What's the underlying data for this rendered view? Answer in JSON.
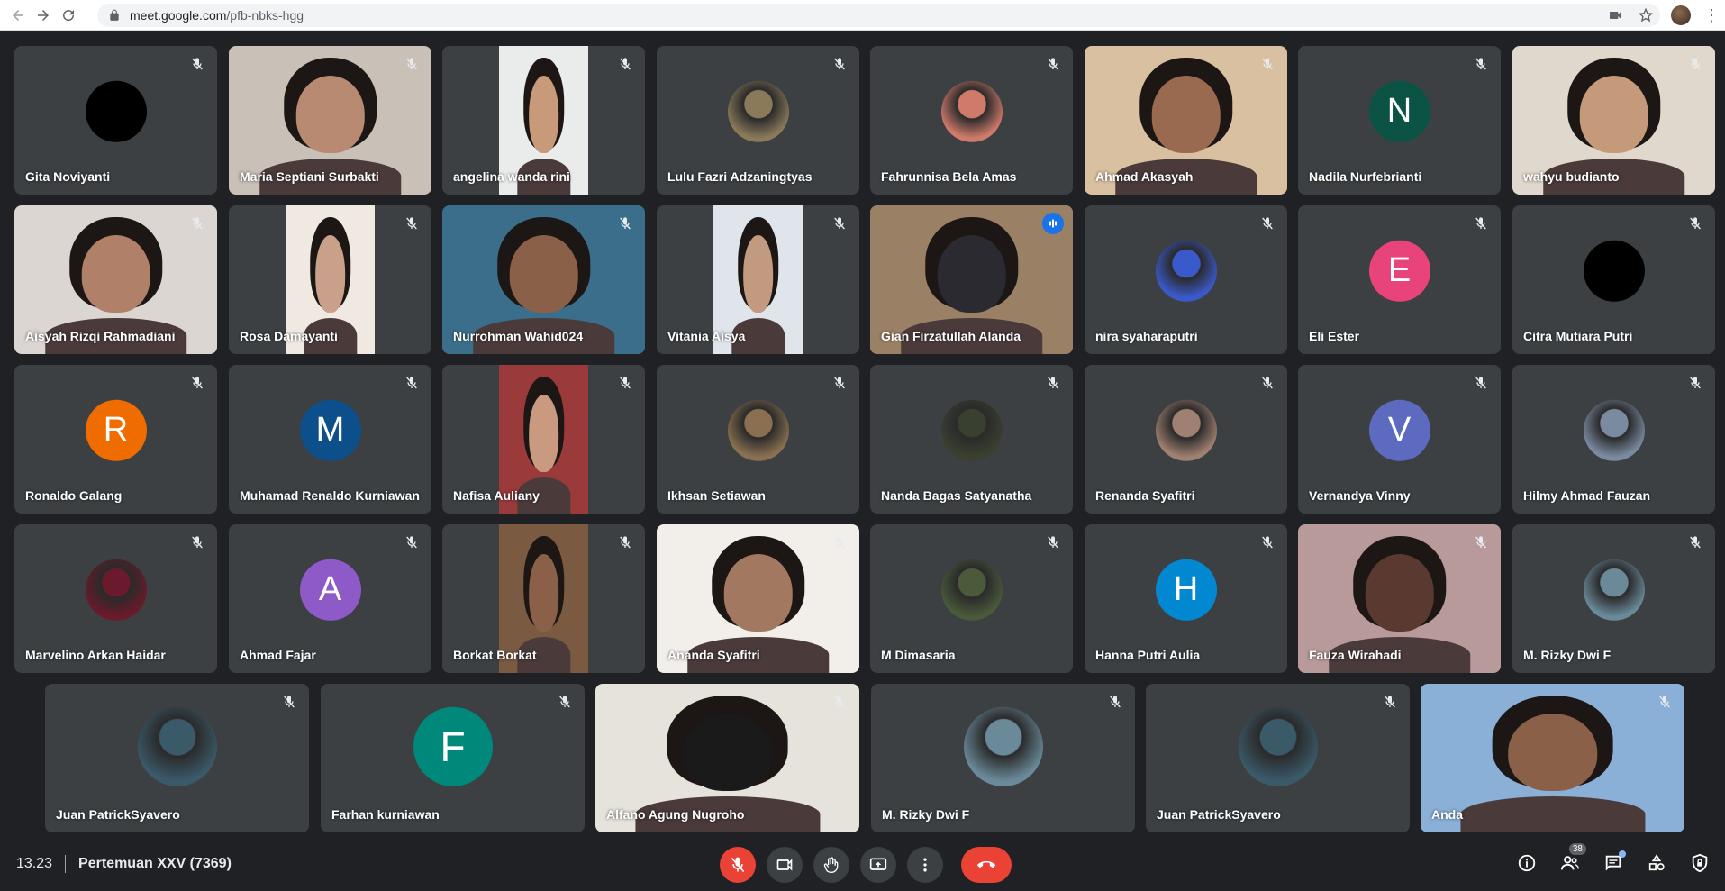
{
  "browser": {
    "url_host": "meet.google.com",
    "url_path": "/pfb-nbks-hgg"
  },
  "colors": {
    "tile_bg": "#3c4043",
    "page_bg": "#202124",
    "accent": "#8ab4f8",
    "danger": "#ea4335"
  },
  "participants": [
    {
      "name": "Gita Noviyanti",
      "kind": "avatar",
      "initial": "",
      "color": "#000000"
    },
    {
      "name": "Maria Septiani Surbakti",
      "kind": "video",
      "tone": "#b98a72",
      "bg": "#c9c0b8"
    },
    {
      "name": "angelina wanda rini",
      "kind": "video-inset",
      "tone": "#c99a7a",
      "bg": "#e9ecea"
    },
    {
      "name": "Lulu Fazri Adzaningtyas",
      "kind": "photo",
      "tone": "#8a7a5a"
    },
    {
      "name": "Fahrunnisa Bela Amas",
      "kind": "photo",
      "tone": "#d07a6a"
    },
    {
      "name": "Ahmad Akasyah",
      "kind": "video",
      "tone": "#9a6a50",
      "bg": "#d8c0a0"
    },
    {
      "name": "Nadila Nurfebrianti",
      "kind": "avatar",
      "initial": "N",
      "color": "#0b5345"
    },
    {
      "name": "wahyu budianto",
      "kind": "video",
      "tone": "#c49a7a",
      "bg": "#e0d8cc"
    },
    {
      "name": "Aisyah Rizqi Rahmadiani",
      "kind": "video",
      "tone": "#b08068",
      "bg": "#dcd6d2"
    },
    {
      "name": "Rosa Damayanti",
      "kind": "video-inset",
      "tone": "#c9a08a",
      "bg": "#efe9e2"
    },
    {
      "name": "Nurrohman Wahid024",
      "kind": "video",
      "tone": "#8a6048",
      "bg": "#3a6e8a"
    },
    {
      "name": "Vitania Aisya",
      "kind": "video-inset",
      "tone": "#c29a80",
      "bg": "#dfe5ea"
    },
    {
      "name": "Gian Firzatullah Alanda",
      "kind": "video",
      "tone": "#2a2a30",
      "bg": "#9a8064",
      "active": true
    },
    {
      "name": "nira syaharaputri",
      "kind": "photo",
      "tone": "#3a5acc"
    },
    {
      "name": "Eli Ester",
      "kind": "avatar",
      "initial": "E",
      "color": "#e8437a"
    },
    {
      "name": "Citra Mutiara Putri",
      "kind": "avatar",
      "initial": "",
      "color": "#000000"
    },
    {
      "name": "Ronaldo Galang",
      "kind": "avatar",
      "initial": "R",
      "color": "#ef6c00"
    },
    {
      "name": "Muhamad Renaldo Kurniawan",
      "kind": "avatar",
      "initial": "M",
      "color": "#0d4f8b"
    },
    {
      "name": "Nafisa Auliany",
      "kind": "video-inset",
      "tone": "#c99a80",
      "bg": "#9a3a3a"
    },
    {
      "name": "Ikhsan Setiawan",
      "kind": "photo",
      "tone": "#8a7050"
    },
    {
      "name": "Nanda Bagas Satyanatha",
      "kind": "photo",
      "tone": "#3a4030"
    },
    {
      "name": "Renanda Syafitri",
      "kind": "photo",
      "tone": "#a08070"
    },
    {
      "name": "Vernandya Vinny",
      "kind": "avatar",
      "initial": "V",
      "color": "#5c6bc0"
    },
    {
      "name": "Hilmy Ahmad Fauzan",
      "kind": "photo",
      "tone": "#7a8aa0"
    },
    {
      "name": "Marvelino Arkan Haidar",
      "kind": "photo",
      "tone": "#6a1a2a"
    },
    {
      "name": "Ahmad Fajar",
      "kind": "avatar",
      "initial": "A",
      "color": "#8e5ac8"
    },
    {
      "name": "Borkat Borkat",
      "kind": "video-inset",
      "tone": "#8a6048",
      "bg": "#7a5a40"
    },
    {
      "name": "Ananda Syafitri",
      "kind": "video",
      "tone": "#a27860",
      "bg": "#f2eeea"
    },
    {
      "name": "M Dimasaria",
      "kind": "photo",
      "tone": "#4a5a3a"
    },
    {
      "name": "Hanna Putri Aulia",
      "kind": "avatar",
      "initial": "H",
      "color": "#0288d1"
    },
    {
      "name": "Fauza Wirahadi",
      "kind": "video",
      "tone": "#5a3a30",
      "bg": "#b89a9a"
    },
    {
      "name": "M. Rizky Dwi F",
      "kind": "photo",
      "tone": "#6a8a9a"
    },
    {
      "name": "Juan PatrickSyavero",
      "kind": "photo",
      "tone": "#3a5a6a",
      "wide": true
    },
    {
      "name": "Farhan kurniawan",
      "kind": "avatar",
      "initial": "F",
      "color": "#00897b",
      "wide": true
    },
    {
      "name": "Alfano Agung Nugroho",
      "kind": "video",
      "tone": "#1a1a1a",
      "bg": "#e6e2dc",
      "wide": true
    },
    {
      "name": "M. Rizky Dwi F",
      "kind": "photo",
      "tone": "#6a8a9a",
      "wide": true
    },
    {
      "name": "Juan PatrickSyavero",
      "kind": "photo",
      "tone": "#3a5a6a",
      "wide": true
    },
    {
      "name": "Anda",
      "kind": "video",
      "tone": "#8a6048",
      "bg": "#8ab0d8",
      "wide": true
    }
  ],
  "bottom_bar": {
    "time": "13.23",
    "meeting_title": "Pertemuan XXV (7369)",
    "participants_count": "38"
  }
}
